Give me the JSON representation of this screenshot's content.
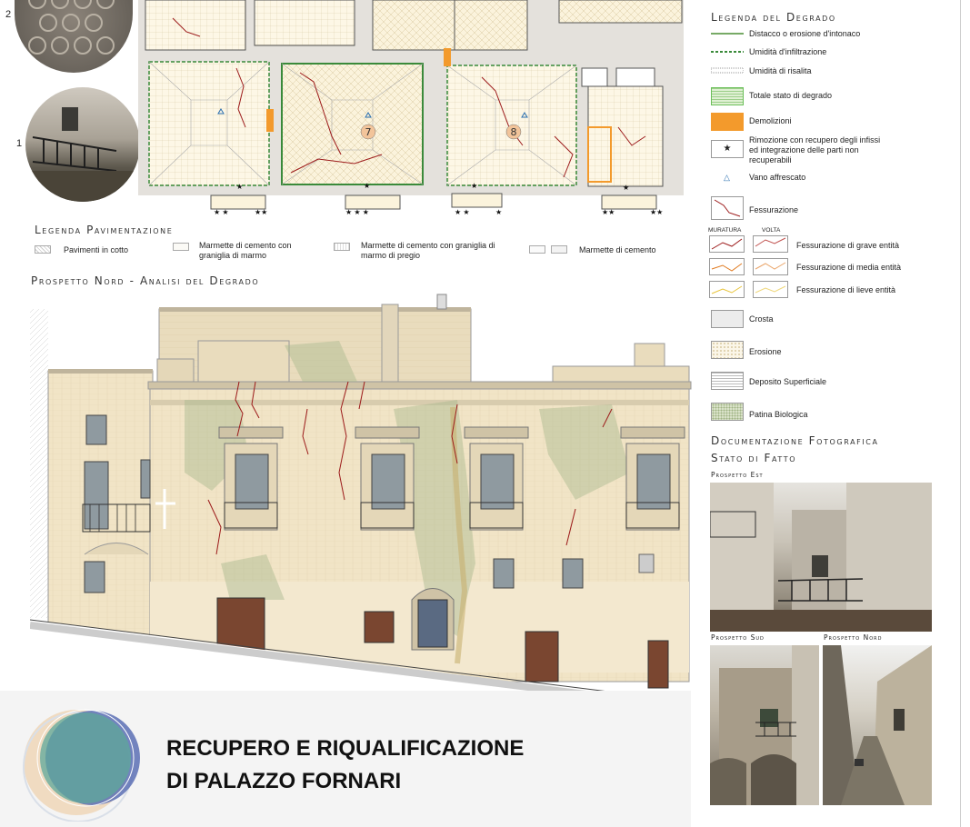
{
  "top_circles": {
    "number_top": "2",
    "number_bottom": "1"
  },
  "plan": {
    "room_7": "7",
    "room_8": "8"
  },
  "legend_degrado": {
    "title": "Legenda del Degrado",
    "items": [
      "Distacco o erosione d'intonaco",
      "Umidità d'infiltrazione",
      "Umidità di risalita",
      "Totale stato di degrado",
      "Demolizioni",
      "Rimozione con recupero degli infissi ed integrazione delle parti non recuperabili",
      "Vano affrescato",
      "Fessurazione"
    ],
    "col_muratura": "MURATURA",
    "col_volta": "VOLTA",
    "fess_grave": "Fessurazione di grave entità",
    "fess_media": "Fessurazione di media entità",
    "fess_lieve": "Fessurazione di lieve entità",
    "crosta": "Crosta",
    "erosione": "Erosione",
    "deposito": "Deposito Superficiale",
    "patina": "Patina Biologica",
    "colors": {
      "demolizioni": "#f39a2c",
      "degrado_green": "#6bbf59",
      "crack_dark": "#9c1a1a",
      "crack_orange": "#e07a1f",
      "crack_yellow": "#e8c43a"
    }
  },
  "legend_pav": {
    "title": "Legenda Pavimentazione",
    "items": [
      "Pavimenti in cotto",
      "Marmette di cemento con graniglia di marmo",
      "Marmette di cemento con graniglia di marmo di pregio",
      "Marmette di cemento"
    ]
  },
  "prospetto_title": "Prospetto Nord - Analisi del Degrado",
  "doc_foto": {
    "title1": "Documentazione Fotografica",
    "title2": "Stato di Fatto",
    "est": "Prospetto Est",
    "sud": "Prospetto Sud",
    "nord": "Prospetto Nord"
  },
  "footer": {
    "line1": "RECUPERO E RIQUALIFICAZIONE",
    "line2": "DI PALAZZO FORNARI"
  }
}
